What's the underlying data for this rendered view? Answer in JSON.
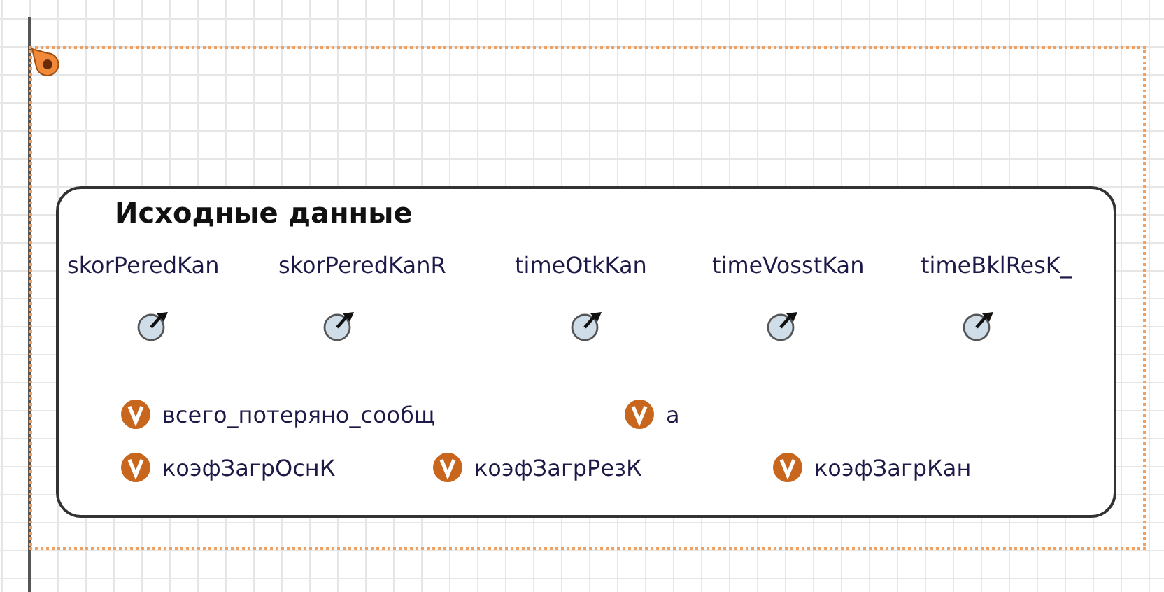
{
  "group": {
    "title": "Исходные данные",
    "parameters": [
      {
        "name": "skorPeredKan"
      },
      {
        "name": "skorPeredKanR"
      },
      {
        "name": "timeOtkKan"
      },
      {
        "name": "timeVosstKan"
      },
      {
        "name": "timeBklResK_"
      }
    ],
    "variables": [
      {
        "name": "всего_потеряно_сообщ"
      },
      {
        "name": "a"
      },
      {
        "name": "коэфЗагрОснК"
      },
      {
        "name": "коэфЗагрРезК"
      },
      {
        "name": "коэфЗагрКан"
      }
    ]
  }
}
